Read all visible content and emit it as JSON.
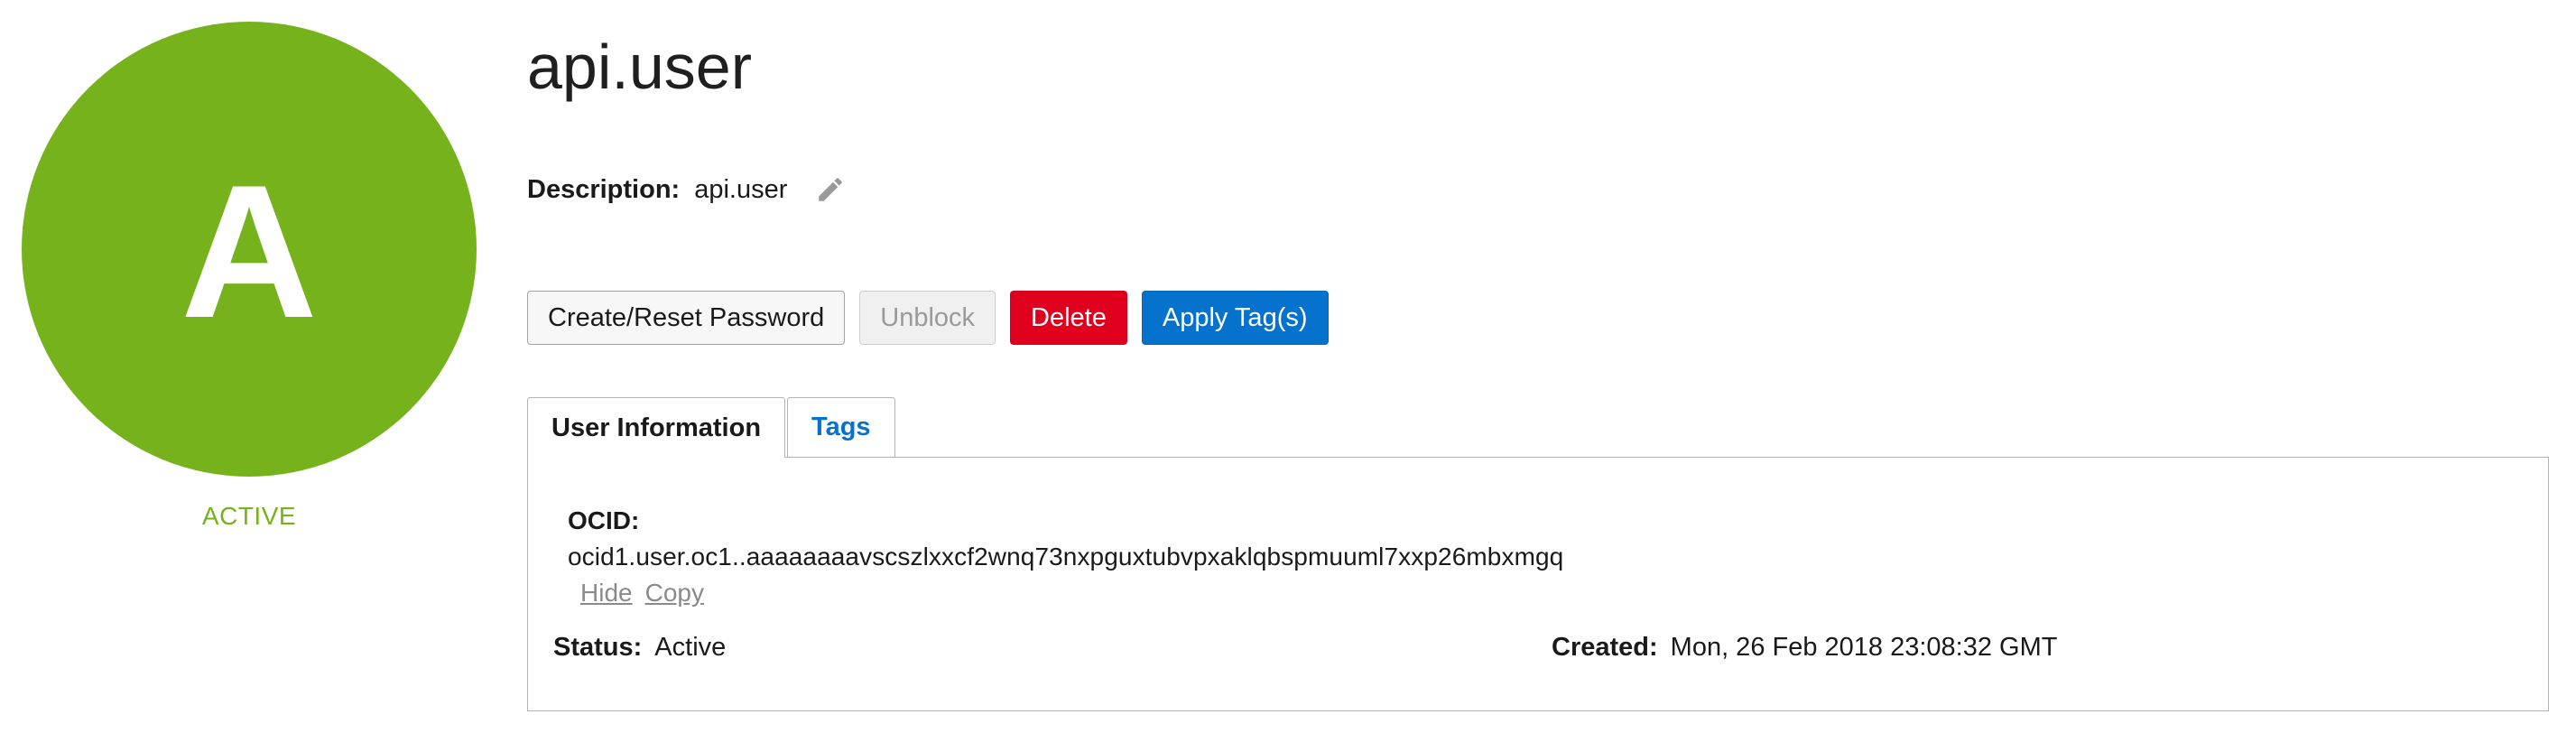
{
  "avatar": {
    "letter": "A",
    "status": "ACTIVE",
    "color": "#75b21b"
  },
  "user": {
    "name": "api.user",
    "description_label": "Description:",
    "description": "api.user"
  },
  "actions": {
    "reset_password": "Create/Reset Password",
    "unblock": "Unblock",
    "delete": "Delete",
    "apply_tags": "Apply Tag(s)"
  },
  "tabs": [
    {
      "label": "User Information",
      "active": true
    },
    {
      "label": "Tags",
      "active": false
    }
  ],
  "info": {
    "ocid_label": "OCID:",
    "ocid": "ocid1.user.oc1..aaaaaaaavscszlxxcf2wnq73nxpguxtubvpxaklqbspmuuml7xxp26mbxmgq",
    "hide": "Hide",
    "copy": "Copy",
    "status_label": "Status:",
    "status": "Active",
    "created_label": "Created:",
    "created": "Mon, 26 Feb 2018 23:08:32 GMT"
  },
  "colors": {
    "accent_green": "#75b21b",
    "danger": "#e0001e",
    "primary": "#0572ce",
    "link_blue": "#0572ce"
  },
  "icons": {
    "edit": "pencil-icon"
  }
}
